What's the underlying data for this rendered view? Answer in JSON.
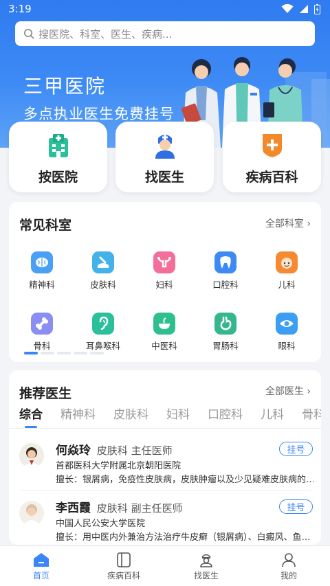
{
  "status_bar": {
    "time": "3:19"
  },
  "search": {
    "placeholder": "搜医院、科室、医生、疾病..."
  },
  "hero": {
    "title": "三甲医院",
    "subtitle": "多点执业医生免费挂号"
  },
  "quick_entries": [
    {
      "label": "按医院",
      "icon": "hospital-building-icon"
    },
    {
      "label": "找医生",
      "icon": "doctor-icon"
    },
    {
      "label": "疾病百科",
      "icon": "medical-shield-icon"
    }
  ],
  "departments": {
    "title": "常见科室",
    "more": "全部科室",
    "items": [
      {
        "label": "精神科",
        "icon": "brain-icon"
      },
      {
        "label": "皮肤科",
        "icon": "skin-icon"
      },
      {
        "label": "妇科",
        "icon": "uterus-icon"
      },
      {
        "label": "口腔科",
        "icon": "tooth-icon"
      },
      {
        "label": "儿科",
        "icon": "baby-icon"
      },
      {
        "label": "骨科",
        "icon": "bone-icon"
      },
      {
        "label": "耳鼻喉科",
        "icon": "ear-icon"
      },
      {
        "label": "中医科",
        "icon": "herbal-bowl-icon"
      },
      {
        "label": "胃肠科",
        "icon": "stomach-icon"
      },
      {
        "label": "眼科",
        "icon": "eye-icon"
      }
    ],
    "page_count": 5,
    "active_page": 1
  },
  "doctors": {
    "title": "推荐医生",
    "more": "全部医生",
    "tabs": [
      "综合",
      "精神科",
      "皮肤科",
      "妇科",
      "口腔科",
      "儿科",
      "骨科"
    ],
    "active_tab": "综合",
    "list": [
      {
        "name": "何焱玲",
        "dept": "皮肤科",
        "title": "主任医师",
        "hospital": "首都医科大学附属北京朝阳医院",
        "specialty": "擅长：银屑病，免疫性皮肤病，皮肤肿瘤以及少见疑难皮肤病的…",
        "action": "挂号"
      },
      {
        "name": "李西霞",
        "dept": "皮肤科",
        "title": "副主任医师",
        "hospital": "中国人民公安大学医院",
        "specialty": "擅长：用中医内外兼治方法治疗牛皮癣（银屑病）、白癜风、鱼…",
        "action": "挂号"
      }
    ]
  },
  "bottom_nav": [
    {
      "label": "首页",
      "icon": "home-icon",
      "active": true
    },
    {
      "label": "疾病百科",
      "icon": "book-icon",
      "active": false
    },
    {
      "label": "找医生",
      "icon": "doctor-nav-icon",
      "active": false
    },
    {
      "label": "我的",
      "icon": "user-icon",
      "active": false
    }
  ],
  "colors": {
    "primary": "#3a86f4",
    "hero_top": "#2f7bf0",
    "background": "#f2f4f8"
  }
}
